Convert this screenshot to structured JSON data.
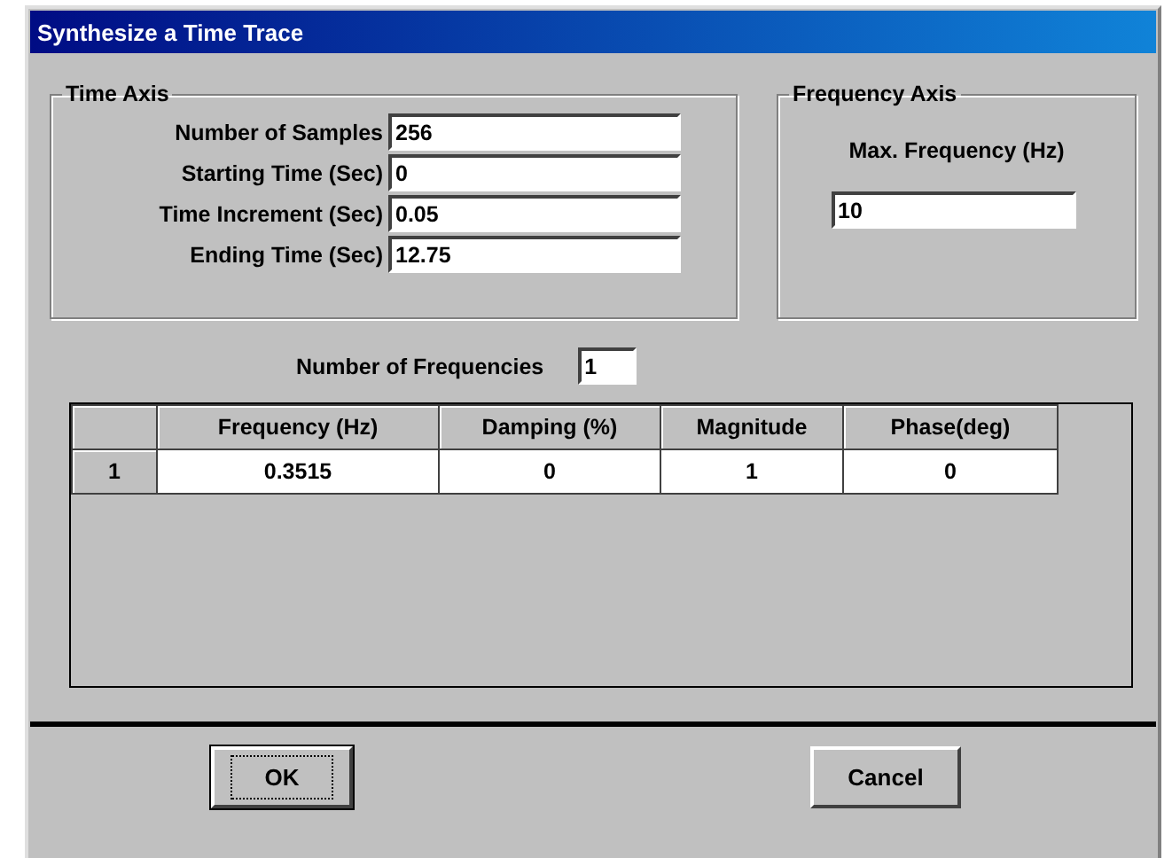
{
  "window": {
    "title": "Synthesize a Time Trace"
  },
  "time_axis": {
    "title": "Time Axis",
    "fields": [
      {
        "label": "Number of Samples",
        "value": "256"
      },
      {
        "label": "Starting Time (Sec)",
        "value": "0"
      },
      {
        "label": "Time Increment (Sec)",
        "value": "0.05"
      },
      {
        "label": "Ending Time (Sec)",
        "value": "12.75"
      }
    ]
  },
  "frequency_axis": {
    "title": "Frequency Axis",
    "label": "Max. Frequency (Hz)",
    "value": "10"
  },
  "number_of_frequencies": {
    "label": "Number of Frequencies",
    "value": "1"
  },
  "table": {
    "columns": [
      "Frequency (Hz)",
      "Damping (%)",
      "Magnitude",
      "Phase(deg)"
    ],
    "rows": [
      {
        "header": "1",
        "cells": [
          "0.3515",
          "0",
          "1",
          "0"
        ]
      }
    ]
  },
  "buttons": [
    {
      "label": "OK",
      "default": true
    },
    {
      "label": "Cancel",
      "default": false
    }
  ]
}
